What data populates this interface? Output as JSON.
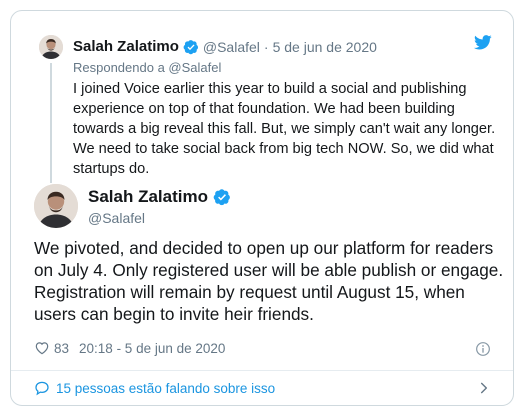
{
  "parent_tweet": {
    "display_name": "Salah Zalatimo",
    "handle": "@Salafel",
    "separator": "·",
    "date": "5 de jun de 2020",
    "replying_to": "Respondendo a @Salafel",
    "text": "I joined Voice earlier this year to build a social and publishing experience on top of that foundation. We had been building towards a big reveal this fall. But, we simply can't wait any longer. We need to take social back from big tech NOW. So, we did what startups do."
  },
  "main_tweet": {
    "display_name": "Salah Zalatimo",
    "handle": "@Salafel",
    "text": "We pivoted, and decided to open up our platform for readers on July 4. Only registered user will be able publish or engage. Registration will remain by request until August 15, when users can begin to invite heir friends.",
    "likes": "83",
    "timestamp": "20:18 - 5 de jun de 2020"
  },
  "footer": {
    "conversation_label": "15 pessoas estão falando sobre isso"
  },
  "icons": {
    "brand": "twitter-bird-icon",
    "verified": "verified-badge-icon",
    "like": "heart-icon",
    "info": "info-icon",
    "conversation": "speech-bubble-icon",
    "chevron": "chevron-right-icon"
  },
  "colors": {
    "brand_blue": "#1da1f2",
    "link_blue": "#1b95e0",
    "muted_text": "#657786",
    "border": "#cfd9de"
  }
}
